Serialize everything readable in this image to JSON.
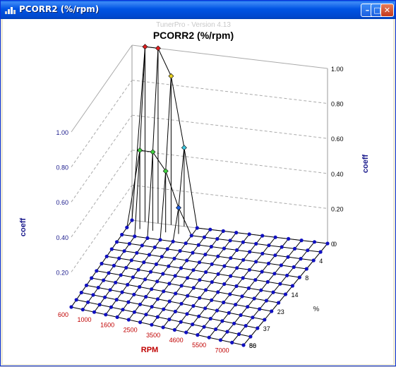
{
  "window": {
    "title": "PCORR2 (%/rpm)",
    "buttons": {
      "minimize": "–",
      "maximize": "□",
      "close": "✕"
    }
  },
  "app_version": "TunerPro - Version 4.13",
  "colors": {
    "titlebar": "#0054e3",
    "grid_marker": "#1010c0",
    "axis_text": "#1a1a8c",
    "rpm_text": "#c00000",
    "red_marker": "#e02020",
    "yellow_marker": "#e8d020",
    "green_marker": "#40d040",
    "cyan_marker": "#40c8e0",
    "blue_marker": "#2060e0"
  },
  "chart_data": {
    "type": "surface3d",
    "title": "PCORR2 (%/rpm)",
    "xlabel": "RPM",
    "ylabel": "coeff",
    "zlabel": "%",
    "x_tick_labels": [
      "600",
      "1000",
      "1600",
      "2500",
      "3500",
      "4600",
      "5500",
      "7000"
    ],
    "y_tick_labels": [
      "0",
      "4",
      "8",
      "14",
      "23",
      "37",
      "56",
      "80"
    ],
    "z_ticks_left": [
      "1.00",
      "0.80",
      "0.60",
      "0.40",
      "0.20"
    ],
    "z_ticks_right": [
      "1.00",
      "0.80",
      "0.60",
      "0.40",
      "0.20",
      "0"
    ],
    "zlim": [
      0,
      1
    ],
    "grid_cols": 16,
    "grid_rows": 13,
    "nonzero_points": [
      {
        "row": 0,
        "col": 1,
        "value": 1.0,
        "color": "red"
      },
      {
        "row": 0,
        "col": 2,
        "value": 1.0,
        "color": "red"
      },
      {
        "row": 0,
        "col": 3,
        "value": 0.85,
        "color": "yellow"
      },
      {
        "row": 0,
        "col": 4,
        "value": 0.45,
        "color": "cyan"
      },
      {
        "row": 1,
        "col": 1,
        "value": 0.45,
        "color": "green"
      },
      {
        "row": 1,
        "col": 2,
        "value": 0.45,
        "color": "green"
      },
      {
        "row": 1,
        "col": 3,
        "value": 0.35,
        "color": "green"
      },
      {
        "row": 1,
        "col": 4,
        "value": 0.15,
        "color": "blue"
      }
    ]
  }
}
